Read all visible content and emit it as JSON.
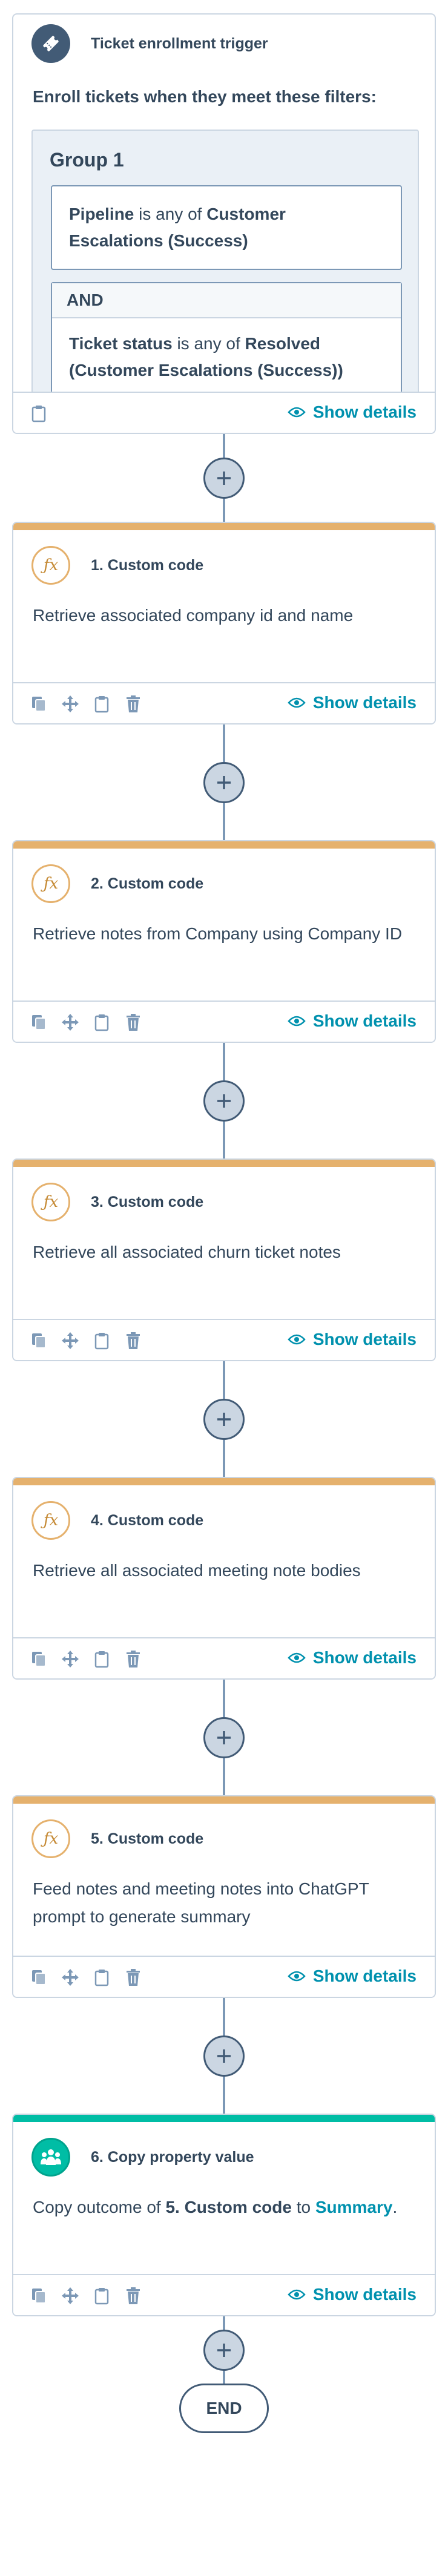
{
  "trigger": {
    "title": "Ticket enrollment trigger",
    "intro": "Enroll tickets when they meet these filters:",
    "group_title": "Group 1",
    "filter1": {
      "prop": "Pipeline",
      "op": " is any of ",
      "value": "Customer Escalations (Success)"
    },
    "and_label": "AND",
    "filter2": {
      "prop": "Ticket status",
      "op": " is any of ",
      "value": "Resolved (Customer Escalations (Success))"
    }
  },
  "show_details": "Show details",
  "actions": [
    {
      "title": "1. Custom code",
      "desc": "Retrieve associated company id and name"
    },
    {
      "title": "2. Custom code",
      "desc": "Retrieve notes from Company using Company ID"
    },
    {
      "title": "3. Custom code",
      "desc": "Retrieve all associated churn ticket notes"
    },
    {
      "title": "4. Custom code",
      "desc": "Retrieve all associated meeting note bodies"
    },
    {
      "title": "5. Custom code",
      "desc": "Feed notes and meeting notes into ChatGPT prompt to generate summary"
    },
    {
      "title": "6. Copy property value",
      "desc_pre": "Copy outcome of ",
      "desc_src": "5. Custom code",
      "desc_mid": " to ",
      "desc_dst": "Summary",
      "desc_end": "."
    }
  ],
  "end_label": "END",
  "colors": {
    "custom_code_bar": "#e5b16d",
    "copy_bar": "#00bda5",
    "link": "#0091ae",
    "text": "#33475b"
  },
  "icons": {
    "trigger": "ticket-icon",
    "custom_code": "fx-icon",
    "copy": "copy-property-icon",
    "add": "plus-icon"
  }
}
